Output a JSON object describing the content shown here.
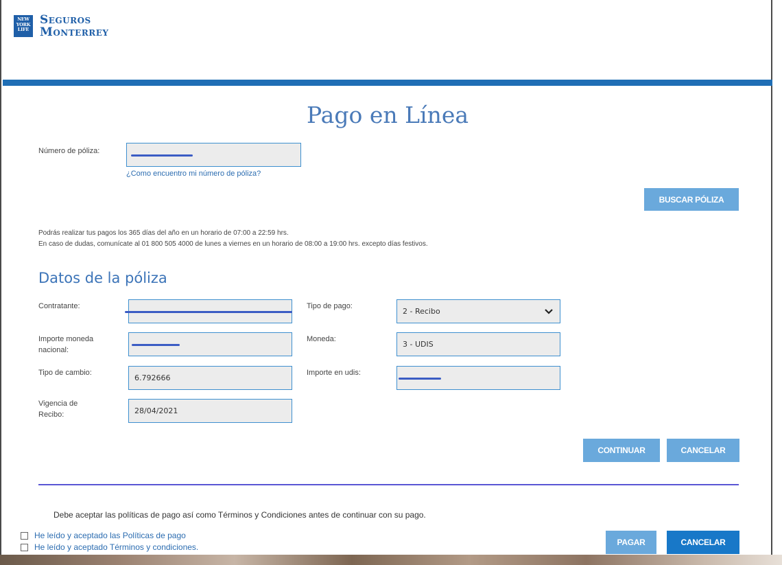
{
  "brand": {
    "badge_line1": "NEW",
    "badge_line2": "YORK",
    "badge_line3": "LIFE",
    "name_line1": "Seguros",
    "name_line2": "Monterrey",
    "color": "#1f6eb5"
  },
  "page": {
    "title": "Pago en Línea"
  },
  "policy_search": {
    "label": "Número de póliza:",
    "help_link": "¿Como encuentro mi número de póliza?",
    "search_button": "BUSCAR PÓLIZA"
  },
  "info": {
    "line1": "Podrás realizar tus pagos los 365 días del año en un horario de 07:00 a 22:59 hrs.",
    "line2": "En caso de dudas, comunícate al 01 800 505 4000 de lunes a viernes en un horario de 08:00 a 19:00 hrs. excepto días festivos."
  },
  "policy_data": {
    "section_title": "Datos de la póliza",
    "contratante_label": "Contratante:",
    "importe_mn_label": "Importe moneda nacional:",
    "tipo_cambio_label": "Tipo de cambio:",
    "tipo_cambio_value": "6.792666",
    "vigencia_label": "Vigencia de Recibo:",
    "vigencia_value": "28/04/2021",
    "tipo_pago_label": "Tipo de pago:",
    "tipo_pago_value": "2 - Recibo",
    "moneda_label": "Moneda:",
    "moneda_value": "3 - UDIS",
    "importe_udis_label": "Importe en udis:"
  },
  "actions": {
    "continue": "CONTINUAR",
    "cancel": "CANCELAR"
  },
  "terms": {
    "notice": "Debe aceptar las políticas de pago así como Términos y Condiciones antes de continuar con su pago.",
    "check_policies": "He leído y aceptado las Políticas de pago",
    "check_terms": "He leído y aceptado Términos y condiciones.",
    "pay_button": "PAGAR",
    "cancel_button": "CANCELAR"
  }
}
